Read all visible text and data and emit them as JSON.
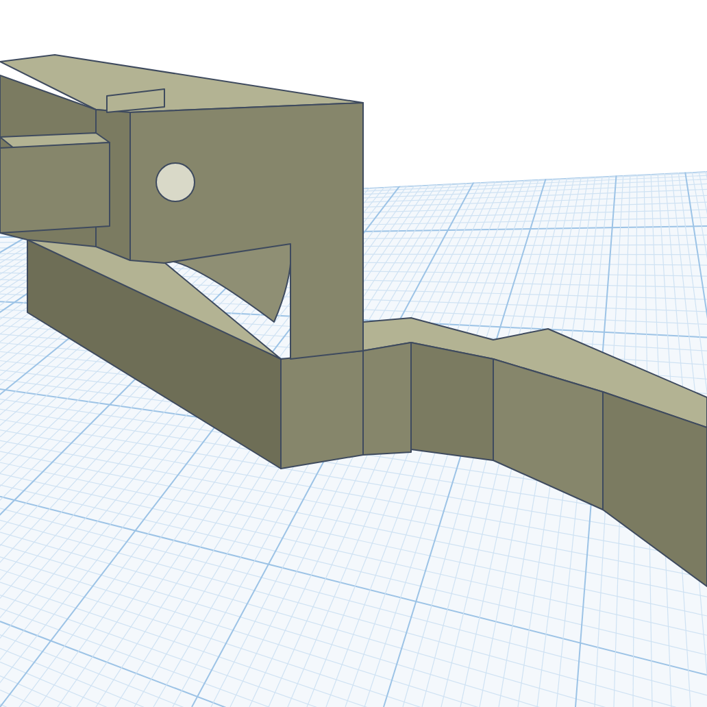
{
  "scene": {
    "kind": "cad-model"
  }
}
